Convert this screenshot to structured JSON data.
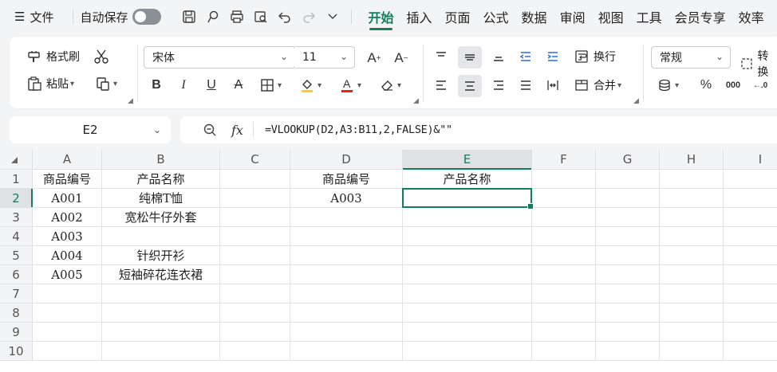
{
  "menubar": {
    "file_label": "文件",
    "autosave_label": "自动保存",
    "tabs": [
      "开始",
      "插入",
      "页面",
      "公式",
      "数据",
      "审阅",
      "视图",
      "工具",
      "会员专享",
      "效率"
    ]
  },
  "ribbon": {
    "format_painter": "格式刷",
    "paste": "粘贴",
    "font_name": "宋体",
    "font_size": "11",
    "wrap": "换行",
    "merge": "合并",
    "number_format": "常规",
    "convert": "转换"
  },
  "formula_bar": {
    "name_box": "E2",
    "formula": "=VLOOKUP(D2,A3:B11,2,FALSE)&\"\""
  },
  "sheet": {
    "columns": [
      "A",
      "B",
      "C",
      "D",
      "E",
      "F",
      "G",
      "H",
      "I"
    ],
    "rows": [
      "1",
      "2",
      "3",
      "4",
      "5",
      "6",
      "7",
      "8",
      "9",
      "10"
    ],
    "active_cell": "E2",
    "cells": {
      "A1": "商品编号",
      "B1": "产品名称",
      "D1": "商品编号",
      "E1": "产品名称",
      "A2": "A001",
      "B2": "纯棉T恤",
      "D2": "A003",
      "A3": "A002",
      "B3": "宽松牛仔外套",
      "A4": "A003",
      "A5": "A004",
      "B5": "针织开衫",
      "A6": "A005",
      "B6": "短袖碎花连衣裙"
    }
  },
  "colors": {
    "accent": "#11805a",
    "font_color_bar": "#e0262b",
    "highlight_bar": "#f7c948"
  }
}
